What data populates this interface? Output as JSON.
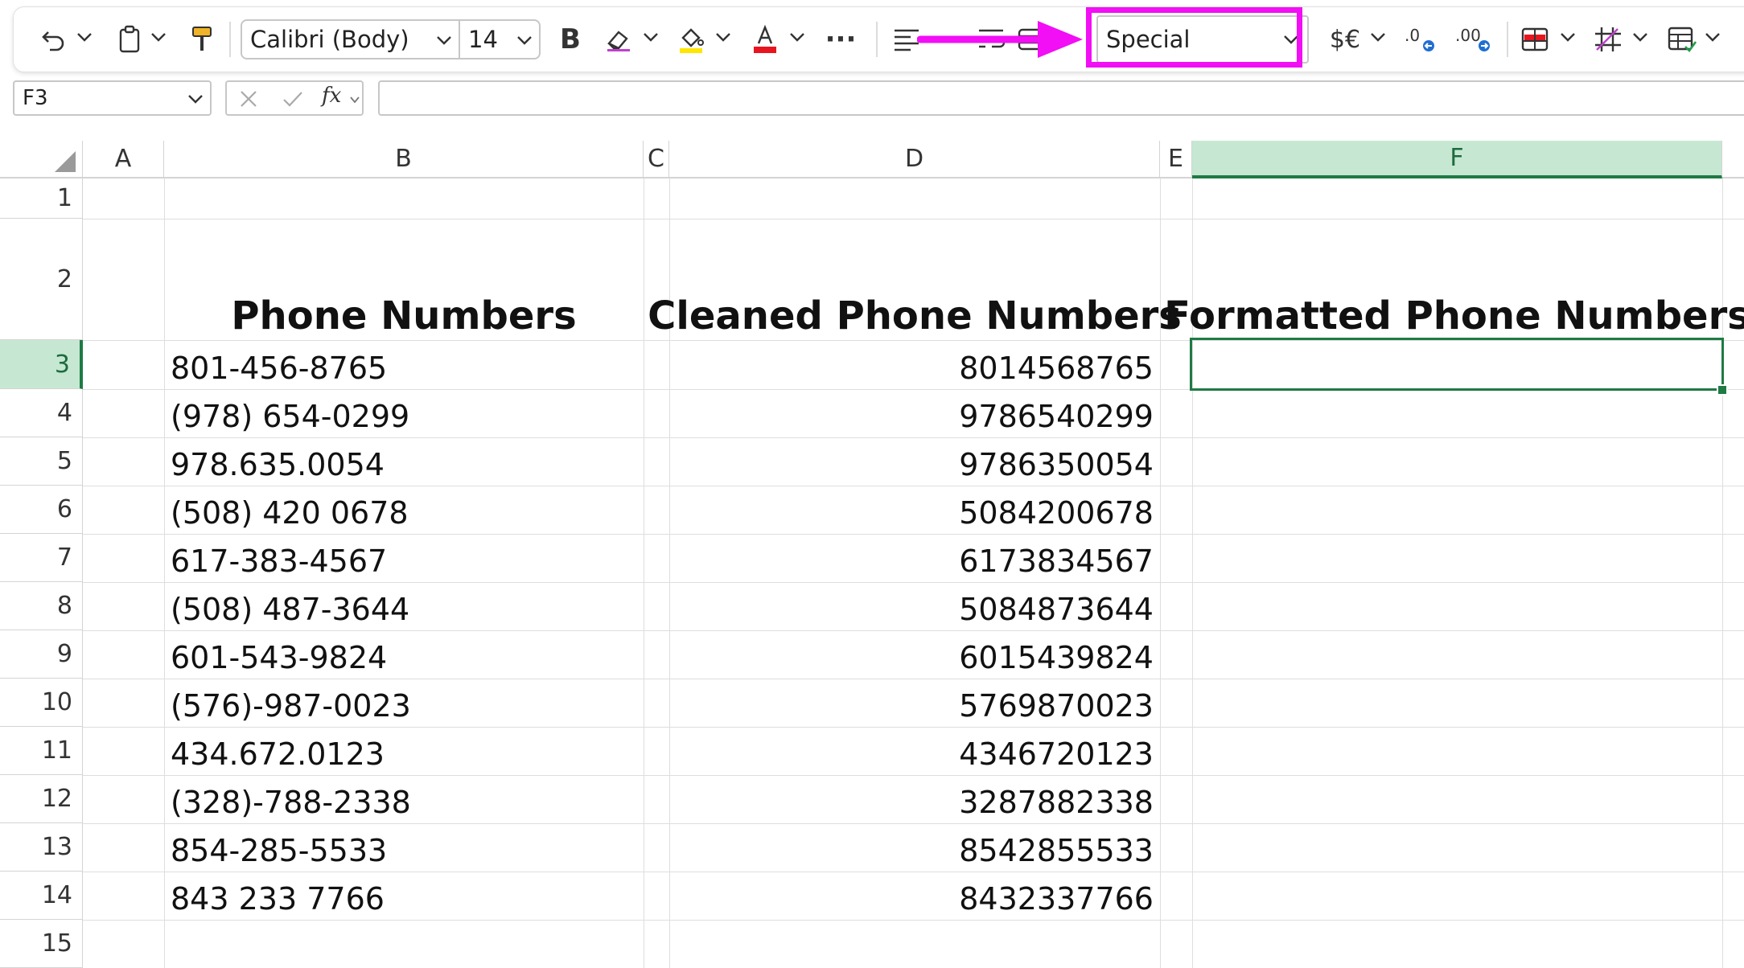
{
  "toolbar": {
    "font_name": "Calibri (Body)",
    "font_size": "14",
    "bold_label": "B",
    "more_label": "···",
    "number_format": "Special",
    "accounting_label": "$€",
    "highlight_color": "#f20ef5",
    "font_color": "#e8141e",
    "fill_color": "#ffe600"
  },
  "formula_bar": {
    "name_box": "F3",
    "fx_label": "fx",
    "formula": ""
  },
  "columns": [
    "A",
    "B",
    "C",
    "D",
    "E",
    "F"
  ],
  "rows": [
    "1",
    "2",
    "3",
    "4",
    "5",
    "6",
    "7",
    "8",
    "9",
    "10",
    "11",
    "12",
    "13",
    "14",
    "15"
  ],
  "headers": {
    "b2": "Phone Numbers",
    "d2": "Cleaned Phone Numbers",
    "f2": "Formatted Phone Numbers"
  },
  "phone_numbers": [
    "801-456-8765",
    "(978) 654-0299",
    "978.635.0054",
    "(508) 420 0678",
    "617-383-4567",
    "(508) 487-3644",
    "601-543-9824",
    "(576)-987-0023",
    "434.672.0123",
    "(328)-788-2338",
    "854-285-5533",
    "843 233 7766"
  ],
  "cleaned_numbers": [
    "8014568765",
    "9786540299",
    "9786350054",
    "5084200678",
    "6173834567",
    "5084873644",
    "6015439824",
    "5769870023",
    "4346720123",
    "3287882338",
    "8542855533",
    "8432337766"
  ]
}
